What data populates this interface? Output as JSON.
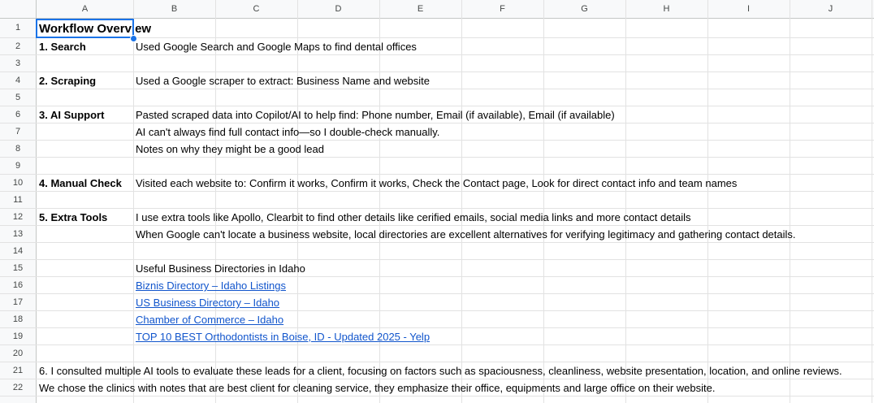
{
  "columns": [
    "A",
    "B",
    "C",
    "D",
    "E",
    "F",
    "G",
    "H",
    "I",
    "J"
  ],
  "rows": [
    "1",
    "2",
    "3",
    "4",
    "5",
    "6",
    "7",
    "8",
    "9",
    "10",
    "11",
    "12",
    "13",
    "14",
    "15",
    "16",
    "17",
    "18",
    "19",
    "20",
    "21",
    "22"
  ],
  "cells": {
    "r1a": "Workflow Overview",
    "r2a": "1. Search",
    "r2b": "Used Google Search and Google Maps to find dental offices",
    "r4a": "2. Scraping",
    "r4b": "Used a Google scraper to extract: Business Name and website",
    "r6a": "3. AI Support",
    "r6b": "Pasted scraped data into Copilot/AI to help find: Phone number, Email (if available), Email (if available)",
    "r7b": "AI can't always find full contact info—so I double-check manually.",
    "r8b": "Notes on why they might be a good lead",
    "r10a": "4. Manual Check",
    "r10b": "Visited each website to: Confirm it works, Confirm it works, Check the Contact page, Look for direct contact info and team names",
    "r12a": "5. Extra Tools",
    "r12b": "I use extra tools like Apollo, Clearbit to find other details like cerified emails, social media links and more contact details",
    "r13b": "When Google can't locate a business website, local directories are excellent alternatives for verifying legitimacy and gathering contact details.",
    "r15b": "Useful Business Directories in Idaho",
    "r16b": "Biznis Directory – Idaho Listings",
    "r17b": "US Business Directory – Idaho",
    "r18b": "Chamber of Commerce – Idaho",
    "r19b": "TOP 10 BEST Orthodontists in Boise, ID - Updated 2025 - Yelp",
    "r21a": "6. I consulted multiple AI tools to evaluate these leads for a client, focusing on factors such as spaciousness, cleanliness, website presentation, location, and online reviews.",
    "r22a": "We chose the clinics with notes that are best client for cleaning service, they emphasize their office, equipments and large office on their website."
  },
  "colors": {
    "link": "#1155cc",
    "selection": "#1a73e8",
    "header_bg": "#f8f9fa",
    "grid": "#e2e2e2"
  }
}
